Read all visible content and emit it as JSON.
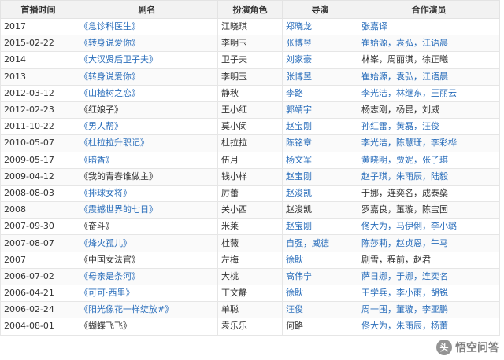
{
  "header": {
    "columns": [
      "首播时间",
      "剧名",
      "扮演角色",
      "导演",
      "合作演员"
    ]
  },
  "rows": [
    {
      "date": "2017",
      "title": "《急诊科医生》",
      "title_link": true,
      "role": "江晓琪",
      "director": "郑晓龙",
      "director_link": true,
      "cast": "张嘉译",
      "cast_link": true
    },
    {
      "date": "2015-02-22",
      "title": "《转身说爱你》",
      "title_link": true,
      "role": "李明玉",
      "director": "张博昱",
      "director_link": true,
      "cast": "崔始源，袁弘，江语晨",
      "cast_link": true
    },
    {
      "date": "2014",
      "title": "《大汉贤后卫子夫》",
      "title_link": true,
      "role": "卫子夫",
      "director": "刘家豪",
      "director_link": true,
      "cast": "林峯，周丽淇，徐正曦",
      "cast_link": false
    },
    {
      "date": "2013",
      "title": "《转身说爱你》",
      "title_link": true,
      "role": "李明玉",
      "director": "张博昱",
      "director_link": true,
      "cast": "崔始源，袁弘，江语晨",
      "cast_link": true
    },
    {
      "date": "2012-03-12",
      "title": "《山楂树之恋》",
      "title_link": true,
      "role": "静秋",
      "director": "李路",
      "director_link": true,
      "cast": "李光洁，林继东，王丽云",
      "cast_link": true
    },
    {
      "date": "2012-02-23",
      "title": "《红娘子》",
      "title_link": false,
      "role": "王小红",
      "director": "郭靖宇",
      "director_link": true,
      "cast": "杨志刚，杨昆，刘威",
      "cast_link": false
    },
    {
      "date": "2011-10-22",
      "title": "《男人帮》",
      "title_link": true,
      "role": "莫小闵",
      "director": "赵宝刚",
      "director_link": true,
      "cast": "孙红雷，黄磊，汪俊",
      "cast_link": true
    },
    {
      "date": "2010-05-07",
      "title": "《杜拉拉升职记》",
      "title_link": true,
      "role": "杜拉拉",
      "director": "陈铭章",
      "director_link": true,
      "cast": "李光洁，陈慧珊，李彩桦",
      "cast_link": true
    },
    {
      "date": "2009-05-17",
      "title": "《暗香》",
      "title_link": true,
      "role": "伍月",
      "director": "杨文军",
      "director_link": true,
      "cast": "黄晓明，贾妮，张子琪",
      "cast_link": true
    },
    {
      "date": "2009-04-12",
      "title": "《我的青春谁做主》",
      "title_link": false,
      "role": "钱小样",
      "director": "赵宝刚",
      "director_link": true,
      "cast": "赵子琪，朱雨辰，陆毅",
      "cast_link": true
    },
    {
      "date": "2008-08-03",
      "title": "《排球女将》",
      "title_link": true,
      "role": "厉蕾",
      "director": "赵浚凯",
      "director_link": true,
      "cast": "于娜，连奕名，成泰燊",
      "cast_link": false
    },
    {
      "date": "2008",
      "title": "《震撼世界的七日》",
      "title_link": true,
      "role": "关小西",
      "director": "赵浚凯",
      "director_link": false,
      "cast": "罗嘉良，董璇，陈宝国",
      "cast_link": false
    },
    {
      "date": "2007-09-30",
      "title": "《奋斗》",
      "title_link": false,
      "role": "米莱",
      "director": "赵宝刚",
      "director_link": true,
      "cast": "佟大为，马伊俐，李小璐",
      "cast_link": true
    },
    {
      "date": "2007-08-07",
      "title": "《烽火孤儿》",
      "title_link": true,
      "role": "杜薇",
      "director": "自强，威德",
      "director_link": true,
      "cast": "陈莎莉，赵贞恩，午马",
      "cast_link": true
    },
    {
      "date": "2007",
      "title": "《中国女法官》",
      "title_link": false,
      "role": "左梅",
      "director": "徐耿",
      "director_link": true,
      "cast": "剧雪，程前，赵君",
      "cast_link": false
    },
    {
      "date": "2006-07-02",
      "title": "《母亲是条河》",
      "title_link": true,
      "role": "大桃",
      "director": "高伟宁",
      "director_link": true,
      "cast": "萨日娜，于娜，连奕名",
      "cast_link": true
    },
    {
      "date": "2006-04-21",
      "title": "《可可·西里》",
      "title_link": true,
      "role": "丁文静",
      "director": "徐耿",
      "director_link": true,
      "cast": "王学兵，李小雨，胡锐",
      "cast_link": true
    },
    {
      "date": "2006-02-24",
      "title": "《阳光像花一样绽放#》",
      "title_link": true,
      "role": "单聪",
      "director": "汪俊",
      "director_link": true,
      "cast": "周一围，董璇，李亚鹏",
      "cast_link": true
    },
    {
      "date": "2004-08-01",
      "title": "《蝴蝶飞飞》",
      "title_link": false,
      "role": "袁乐乐",
      "director": "何路",
      "director_link": false,
      "cast": "佟大为，朱雨辰，杨蕾",
      "cast_link": true
    }
  ],
  "watermark": {
    "badge": "头",
    "text": "悟空问答"
  },
  "colors": {
    "link": "#2a6ebb",
    "header_bg": "#f2f2f2",
    "border": "#e6e6e6"
  }
}
